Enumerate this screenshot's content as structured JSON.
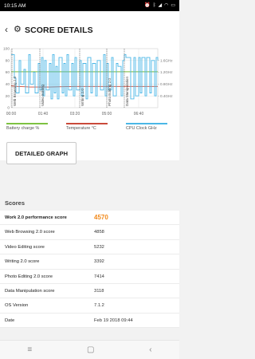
{
  "status_bar": {
    "time": "10:15 AM",
    "icons": [
      "alarm-icon",
      "bluetooth-icon",
      "signal-icon",
      "wifi-icon",
      "battery-icon"
    ]
  },
  "header": {
    "title": "SCORE DETAILS",
    "back_icon": "chevron-left-icon",
    "logo_icon": "gear-icon"
  },
  "chart_data": {
    "type": "line",
    "x_ticks": [
      "00:00",
      "01:40",
      "03:20",
      "05:00",
      "06:40"
    ],
    "y_left_ticks": [
      "100",
      "80",
      "60",
      "40",
      "20",
      "0"
    ],
    "y_right_ticks": [
      "1.6GHz",
      "1.2GHz",
      "0.8GHz",
      "0.4GHz"
    ],
    "ylim_left": [
      0,
      100
    ],
    "ylim_right": [
      0,
      2.0
    ],
    "xlim_minutes": [
      0,
      460
    ],
    "grid": true,
    "sections": [
      {
        "label": "Web Browsing 2.0",
        "start_min": 0
      },
      {
        "label": "Video Editing",
        "start_min": 90
      },
      {
        "label": "Writing 2.0",
        "start_min": 215
      },
      {
        "label": "Photo Editing 2.0",
        "start_min": 300
      },
      {
        "label": "Data Manipulation",
        "start_min": 355
      }
    ],
    "series": [
      {
        "name": "Battery charge %",
        "color": "#7ec242",
        "x_min": [
          0,
          460
        ],
        "values": [
          61,
          61
        ]
      },
      {
        "name": "Temperature °C",
        "color": "#c94a3a",
        "x_min": [
          0,
          20,
          60,
          120,
          200,
          280,
          360,
          460
        ],
        "values": [
          37,
          36,
          35,
          35,
          36,
          36,
          36,
          36
        ]
      },
      {
        "name": "CPU Clock GHz",
        "color": "#4bb7e6",
        "x_min": [
          0,
          10,
          15,
          25,
          30,
          40,
          45,
          55,
          60,
          70,
          75,
          85,
          90,
          95,
          100,
          105,
          110,
          120,
          125,
          130,
          135,
          140,
          145,
          150,
          160,
          165,
          170,
          175,
          180,
          190,
          195,
          200,
          205,
          215,
          220,
          225,
          235,
          240,
          250,
          255,
          265,
          270,
          280,
          290,
          295,
          300,
          305,
          315,
          320,
          330,
          335,
          345,
          350,
          355,
          360,
          370,
          375,
          385,
          390,
          400,
          405,
          410,
          420,
          425,
          435,
          440,
          450,
          455,
          460
        ],
        "values": [
          1.8,
          1.0,
          0.5,
          1.6,
          0.8,
          1.3,
          0.5,
          1.8,
          0.8,
          1.2,
          0.5,
          1.5,
          0.6,
          1.7,
          0.4,
          1.6,
          0.6,
          1.5,
          0.3,
          1.8,
          0.5,
          1.4,
          0.3,
          1.7,
          0.5,
          1.5,
          0.4,
          1.8,
          0.6,
          1.5,
          0.4,
          1.7,
          0.6,
          1.6,
          0.4,
          1.5,
          0.3,
          1.7,
          0.5,
          1.5,
          0.4,
          1.6,
          0.6,
          1.8,
          0.4,
          1.5,
          0.6,
          1.7,
          0.4,
          1.5,
          1.4,
          0.4,
          1.6,
          1.8,
          1.7,
          1.7,
          0.3,
          1.7,
          0.4,
          1.7,
          0.5,
          1.7,
          0.4,
          1.7,
          0.5,
          1.6,
          0.4,
          1.7,
          1.6
        ]
      }
    ]
  },
  "legend": [
    {
      "label": "Battery charge %",
      "color": "#7ec242"
    },
    {
      "label": "Temperature °C",
      "color": "#c94a3a"
    },
    {
      "label": "CPU Clock GHz",
      "color": "#4bb7e6"
    }
  ],
  "detailed_graph_button": "DETAILED GRAPH",
  "scores_heading": "Scores",
  "scores": [
    {
      "name": "Work 2.0 performance score",
      "value": "4570"
    },
    {
      "name": "Web Browsing 2.0 score",
      "value": "4858"
    },
    {
      "name": "Video Editing score",
      "value": "5232"
    },
    {
      "name": "Writing 2.0 score",
      "value": "3392"
    },
    {
      "name": "Photo Editing 2.0 score",
      "value": "7414"
    },
    {
      "name": "Data Manipulation score",
      "value": "3118"
    },
    {
      "name": "OS Version",
      "value": "7.1.2"
    },
    {
      "name": "Date",
      "value": "Feb 19 2018 09:44"
    }
  ],
  "nav": {
    "menu_icon": "≡",
    "home_icon": "▢",
    "back_icon": "‹"
  }
}
